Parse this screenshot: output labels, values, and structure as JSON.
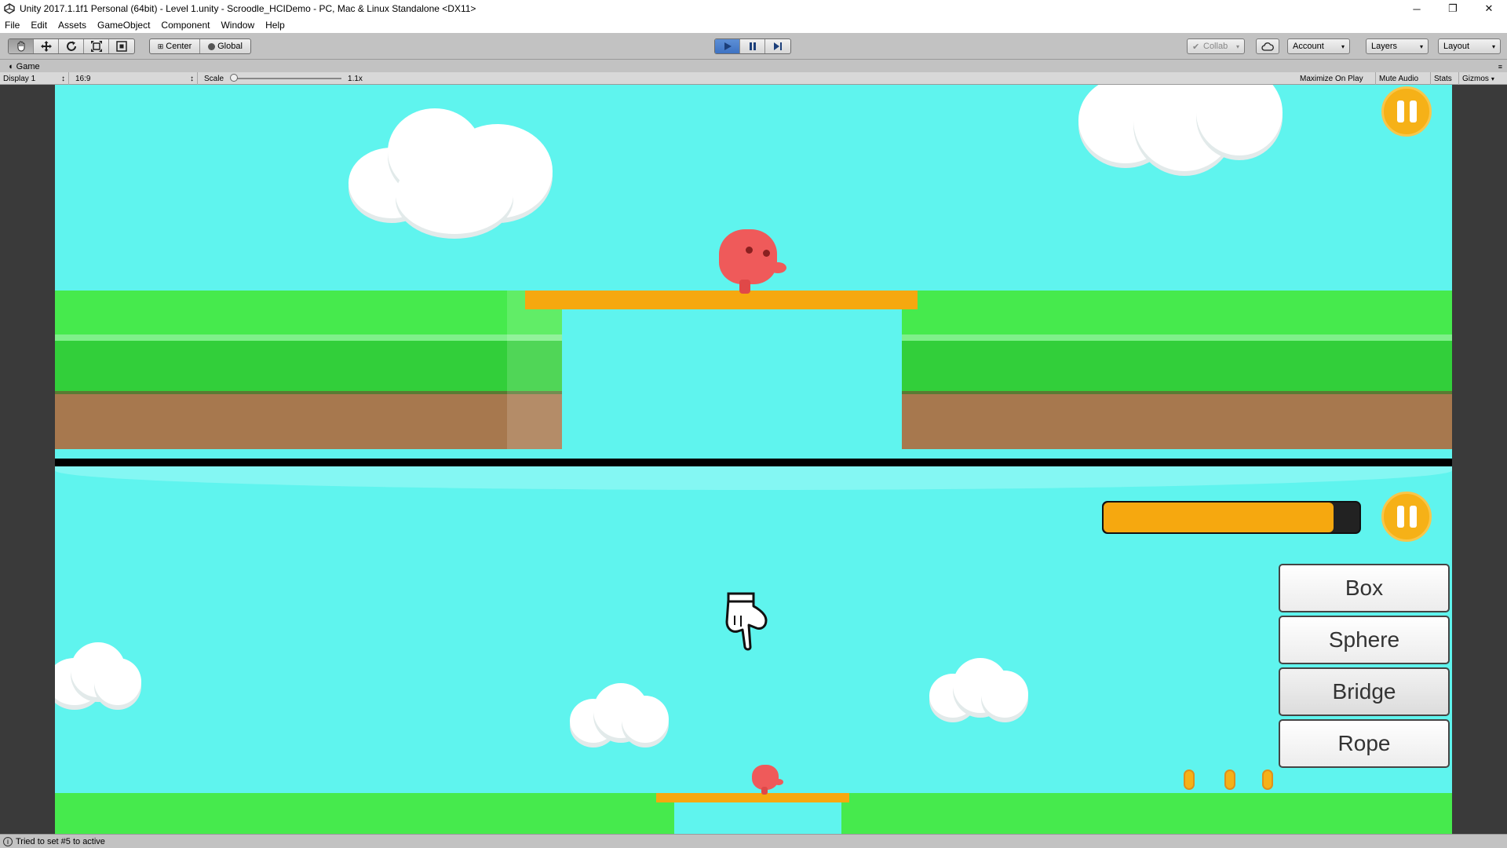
{
  "window": {
    "title": "Unity 2017.1.1f1 Personal (64bit) - Level 1.unity - Scroodle_HCIDemo - PC, Mac & Linux Standalone <DX11>",
    "controls": [
      "─",
      "❐",
      "✕"
    ]
  },
  "menu": [
    "File",
    "Edit",
    "Assets",
    "GameObject",
    "Component",
    "Window",
    "Help"
  ],
  "toolbar": {
    "pivot_label": "Center",
    "space_label": "Global",
    "collab_label": "Collab",
    "account_label": "Account",
    "layers_label": "Layers",
    "layout_label": "Layout",
    "arrow": "▾"
  },
  "game_tab": {
    "label": "Game",
    "display": "Display 1",
    "aspect": "16:9",
    "scale_label": "Scale",
    "scale_value": "1.1x",
    "maximize": "Maximize On Play",
    "mute": "Mute Audio",
    "stats": "Stats",
    "gizmos": "Gizmos"
  },
  "hud": {
    "progress": 0.9,
    "shape_buttons": [
      "Box",
      "Sphere",
      "Bridge",
      "Rope"
    ],
    "selected_button": "Bridge"
  },
  "colors": {
    "sky": "#5ff4ee",
    "grass": "#46ea4d",
    "dirt": "#a7784e",
    "plank": "#f6a80f",
    "player": "#ef5a5a",
    "accent": "#f6b117"
  },
  "status": {
    "message": "Tried to set #5 to active"
  }
}
